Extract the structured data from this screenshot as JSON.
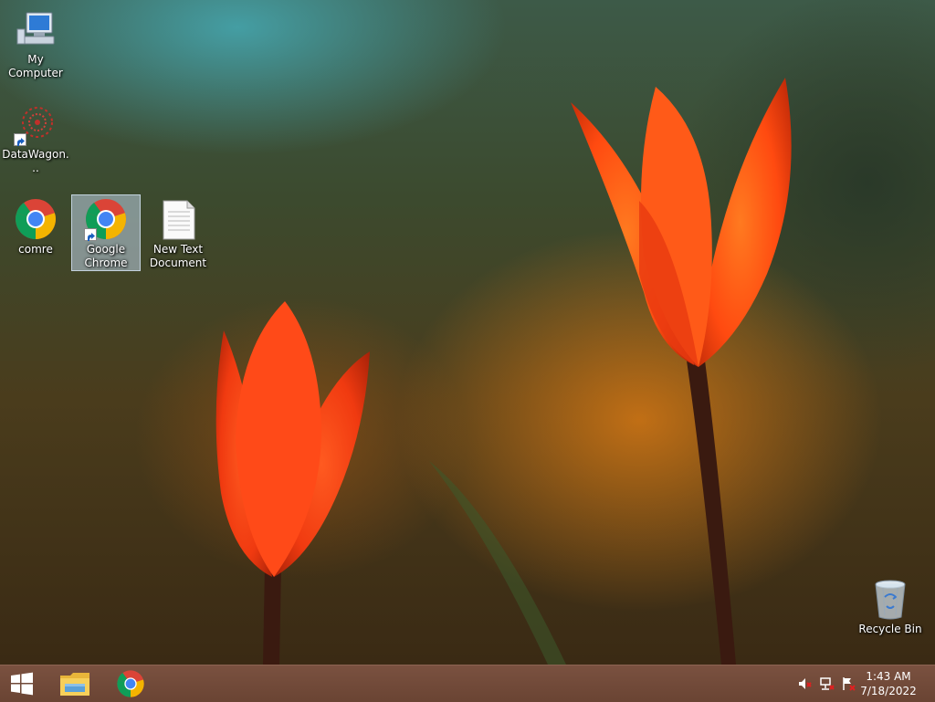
{
  "desktop": {
    "icons": [
      {
        "label": "My Computer",
        "icon": "computer-icon"
      },
      {
        "label": "DataWagon...",
        "icon": "datawagon-icon"
      },
      {
        "label": "comre",
        "icon": "chrome-icon"
      },
      {
        "label": "Google Chrome",
        "icon": "chrome-icon",
        "selected": true
      },
      {
        "label": "New Text Document",
        "icon": "text-document-icon"
      },
      {
        "label": "Recycle Bin",
        "icon": "recycle-bin-icon"
      }
    ]
  },
  "taskbar": {
    "start": {
      "icon": "windows-logo-icon"
    },
    "pinned": [
      {
        "name": "File Explorer",
        "icon": "folder-icon"
      },
      {
        "name": "Google Chrome",
        "icon": "chrome-icon"
      }
    ],
    "tray": [
      {
        "icon": "volume-muted-icon"
      },
      {
        "icon": "network-icon"
      },
      {
        "icon": "action-center-flag-icon"
      }
    ],
    "clock": {
      "time": "1:43 AM",
      "date": "7/18/2022"
    }
  },
  "colors": {
    "taskbar": "#6f4838",
    "tulip": "#ff4a10",
    "selection": "#bed2e6"
  }
}
